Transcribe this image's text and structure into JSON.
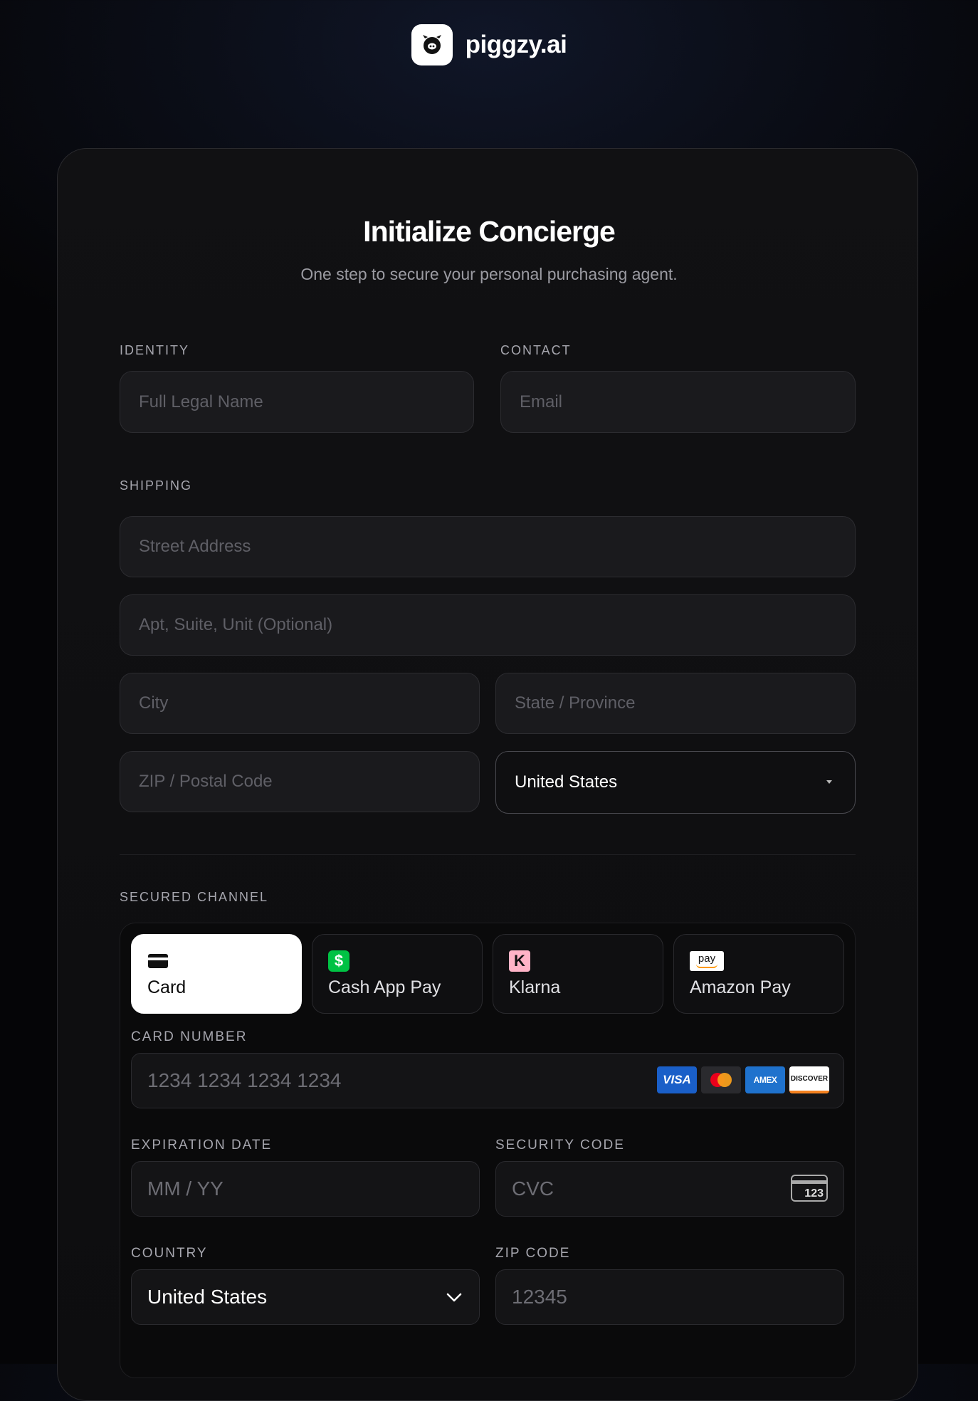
{
  "header": {
    "brand": "piggzy.ai",
    "logo_icon": "pig-face-icon"
  },
  "panel": {
    "title": "Initialize Concierge",
    "subtitle": "One step to secure your personal purchasing agent."
  },
  "identity": {
    "label": "IDENTITY",
    "name_placeholder": "Full Legal Name"
  },
  "contact": {
    "label": "CONTACT",
    "email_placeholder": "Email"
  },
  "shipping": {
    "label": "SHIPPING",
    "street_placeholder": "Street Address",
    "apt_placeholder": "Apt, Suite, Unit (Optional)",
    "city_placeholder": "City",
    "state_placeholder": "State / Province",
    "zip_placeholder": "ZIP / Postal Code",
    "country_value": "United States"
  },
  "payment": {
    "label": "SECURED CHANNEL",
    "tabs": [
      {
        "label": "Card",
        "icon": "credit-card-icon",
        "active": true
      },
      {
        "label": "Cash App Pay",
        "icon": "cash-app-icon",
        "active": false
      },
      {
        "label": "Klarna",
        "icon": "klarna-icon",
        "active": false
      },
      {
        "label": "Amazon Pay",
        "icon": "amazon-pay-icon",
        "active": false
      }
    ],
    "card_number_label": "CARD NUMBER",
    "card_number_placeholder": "1234 1234 1234 1234",
    "card_brands": [
      "VISA",
      "Mastercard",
      "AMEX",
      "DISCOVER"
    ],
    "expiration_label": "EXPIRATION DATE",
    "expiration_placeholder": "MM / YY",
    "security_label": "SECURITY CODE",
    "security_placeholder": "CVC",
    "cvc_icon_text": "123",
    "country_label": "COUNTRY",
    "country_value": "United States",
    "zip_label": "ZIP CODE",
    "zip_placeholder": "12345"
  },
  "colors": {
    "background": "#050507",
    "panel": "#111113",
    "field": "#1a1a1d",
    "active_tab": "#ffffff"
  }
}
